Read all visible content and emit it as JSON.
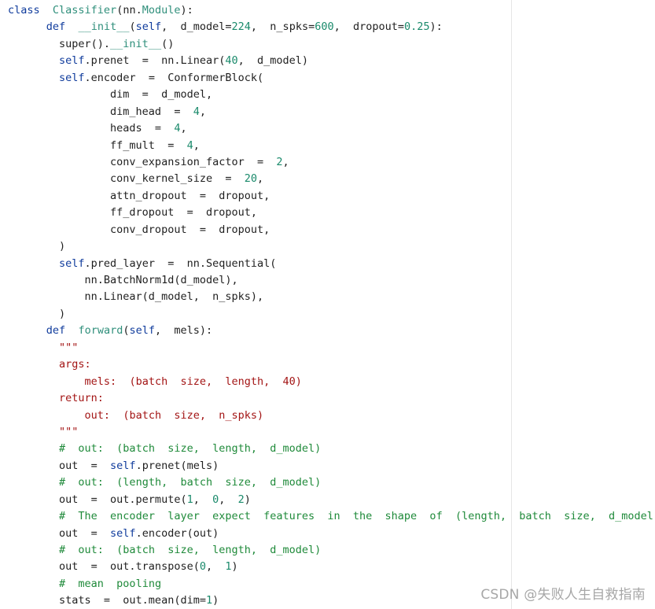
{
  "code_lines": [
    [
      {
        "t": "class",
        "c": "kw"
      },
      {
        "t": "  "
      },
      {
        "t": "Classifier",
        "c": "cls"
      },
      {
        "t": "(nn."
      },
      {
        "t": "Module",
        "c": "cls"
      },
      {
        "t": "):"
      }
    ],
    [
      {
        "t": "      "
      },
      {
        "t": "def",
        "c": "kw"
      },
      {
        "t": "  "
      },
      {
        "t": "__init__",
        "c": "cls"
      },
      {
        "t": "("
      },
      {
        "t": "self",
        "c": "self"
      },
      {
        "t": ",  d_model="
      },
      {
        "t": "224",
        "c": "num"
      },
      {
        "t": ",  n_spks="
      },
      {
        "t": "600",
        "c": "num"
      },
      {
        "t": ",  dropout="
      },
      {
        "t": "0.25",
        "c": "num"
      },
      {
        "t": "):"
      }
    ],
    [
      {
        "t": "        super()."
      },
      {
        "t": "__init__",
        "c": "cls"
      },
      {
        "t": "()"
      }
    ],
    [
      {
        "t": "        "
      },
      {
        "t": "self",
        "c": "self"
      },
      {
        "t": ".prenet  =  nn.Linear("
      },
      {
        "t": "40",
        "c": "num"
      },
      {
        "t": ",  d_model)"
      }
    ],
    [
      {
        "t": "        "
      },
      {
        "t": "self",
        "c": "self"
      },
      {
        "t": ".encoder  =  ConformerBlock("
      }
    ],
    [
      {
        "t": "                dim  =  d_model,"
      }
    ],
    [
      {
        "t": "                dim_head  =  "
      },
      {
        "t": "4",
        "c": "num"
      },
      {
        "t": ","
      }
    ],
    [
      {
        "t": "                heads  =  "
      },
      {
        "t": "4",
        "c": "num"
      },
      {
        "t": ","
      }
    ],
    [
      {
        "t": "                ff_mult  =  "
      },
      {
        "t": "4",
        "c": "num"
      },
      {
        "t": ","
      }
    ],
    [
      {
        "t": "                conv_expansion_factor  =  "
      },
      {
        "t": "2",
        "c": "num"
      },
      {
        "t": ","
      }
    ],
    [
      {
        "t": "                conv_kernel_size  =  "
      },
      {
        "t": "20",
        "c": "num"
      },
      {
        "t": ","
      }
    ],
    [
      {
        "t": "                attn_dropout  =  dropout,"
      }
    ],
    [
      {
        "t": "                ff_dropout  =  dropout,"
      }
    ],
    [
      {
        "t": "                conv_dropout  =  dropout,"
      }
    ],
    [
      {
        "t": "        )"
      }
    ],
    [
      {
        "t": "        "
      },
      {
        "t": "self",
        "c": "self"
      },
      {
        "t": ".pred_layer  =  nn.Sequential("
      }
    ],
    [
      {
        "t": "            nn.BatchNorm1d(d_model),"
      }
    ],
    [
      {
        "t": "            nn.Linear(d_model,  n_spks),"
      }
    ],
    [
      {
        "t": "        )"
      }
    ],
    [
      {
        "t": "      "
      },
      {
        "t": "def",
        "c": "kw"
      },
      {
        "t": "  "
      },
      {
        "t": "forward",
        "c": "cls"
      },
      {
        "t": "("
      },
      {
        "t": "self",
        "c": "self"
      },
      {
        "t": ",  mels):"
      }
    ],
    [
      {
        "t": "        "
      },
      {
        "t": "\"\"\"",
        "c": "str"
      }
    ],
    [
      {
        "t": "        "
      },
      {
        "t": "args:",
        "c": "str"
      }
    ],
    [
      {
        "t": "            "
      },
      {
        "t": "mels:  (batch  size,  length,  40)",
        "c": "str"
      }
    ],
    [
      {
        "t": "        "
      },
      {
        "t": "return:",
        "c": "str"
      }
    ],
    [
      {
        "t": "            "
      },
      {
        "t": "out:  (batch  size,  n_spks)",
        "c": "str"
      }
    ],
    [
      {
        "t": "        "
      },
      {
        "t": "\"\"\"",
        "c": "str"
      }
    ],
    [
      {
        "t": "        "
      },
      {
        "t": "#  out:  (batch  size,  length,  d_model)",
        "c": "com"
      }
    ],
    [
      {
        "t": "        out  =  "
      },
      {
        "t": "self",
        "c": "self"
      },
      {
        "t": ".prenet(mels)"
      }
    ],
    [
      {
        "t": "        "
      },
      {
        "t": "#  out:  (length,  batch  size,  d_model)",
        "c": "com"
      }
    ],
    [
      {
        "t": "        out  =  out.permute("
      },
      {
        "t": "1",
        "c": "num"
      },
      {
        "t": ",  "
      },
      {
        "t": "0",
        "c": "num"
      },
      {
        "t": ",  "
      },
      {
        "t": "2",
        "c": "num"
      },
      {
        "t": ")"
      }
    ],
    [
      {
        "t": "        "
      },
      {
        "t": "#  The  encoder  layer  expect  features  in  the  shape  of  (length,  batch  size,  d_model).",
        "c": "com"
      }
    ],
    [
      {
        "t": "        out  =  "
      },
      {
        "t": "self",
        "c": "self"
      },
      {
        "t": ".encoder(out)"
      }
    ],
    [
      {
        "t": "        "
      },
      {
        "t": "#  out:  (batch  size,  length,  d_model)",
        "c": "com"
      }
    ],
    [
      {
        "t": "        out  =  out.transpose("
      },
      {
        "t": "0",
        "c": "num"
      },
      {
        "t": ",  "
      },
      {
        "t": "1",
        "c": "num"
      },
      {
        "t": ")"
      }
    ],
    [
      {
        "t": "        "
      },
      {
        "t": "#  mean  pooling",
        "c": "com"
      }
    ],
    [
      {
        "t": "        stats  =  out.mean(dim="
      },
      {
        "t": "1",
        "c": "num"
      },
      {
        "t": ")"
      }
    ]
  ],
  "watermark": "CSDN @失败人生自救指南"
}
